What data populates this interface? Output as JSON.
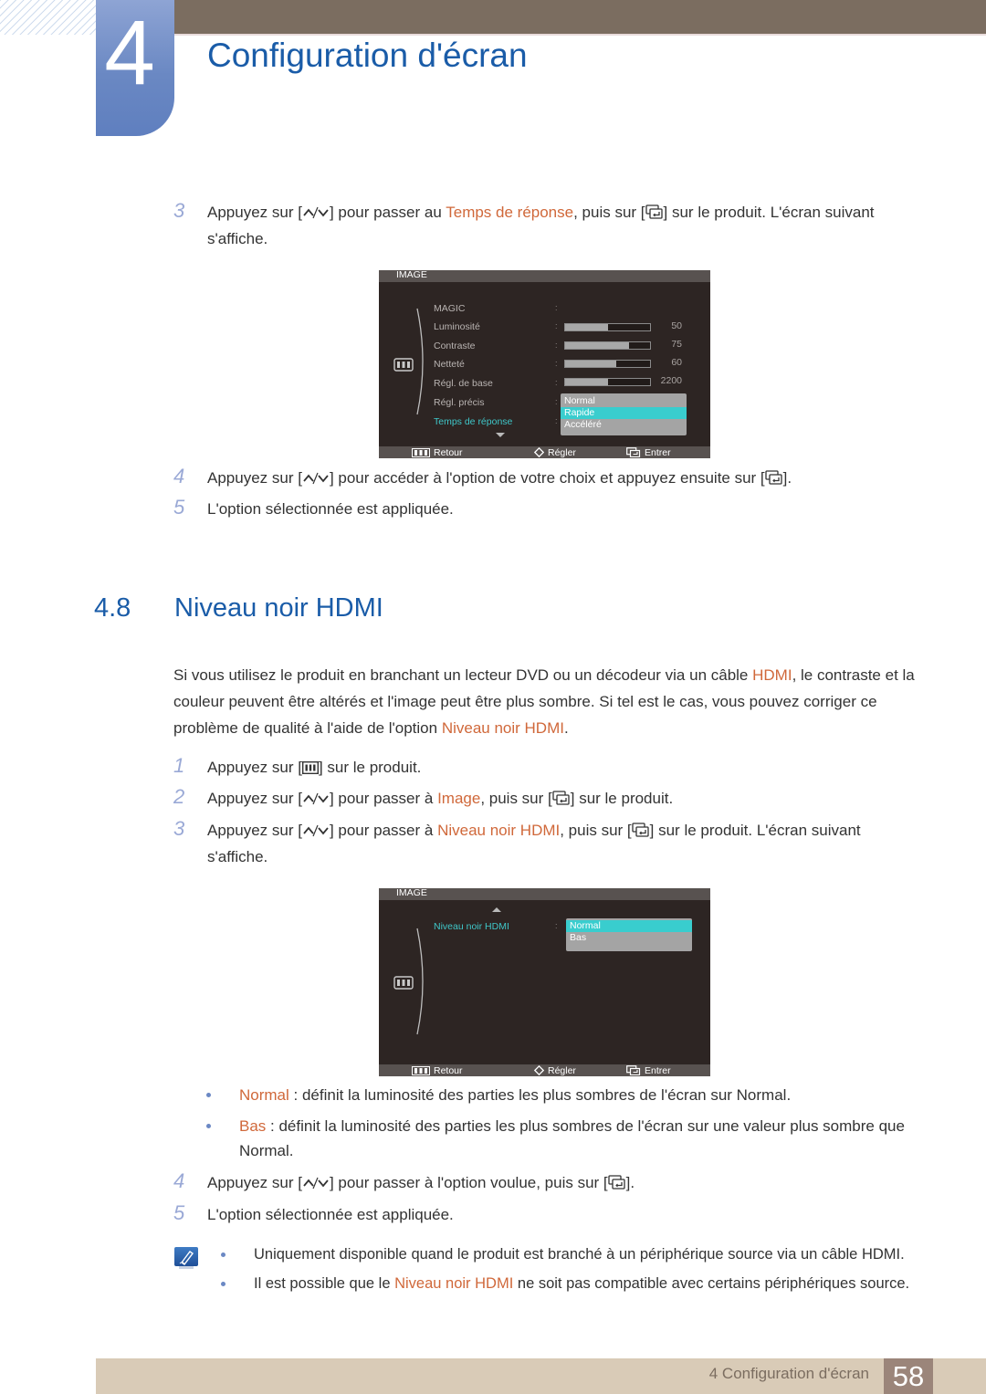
{
  "header": {
    "chapter_number": "4",
    "chapter_title": "Configuration d'écran"
  },
  "colors": {
    "title_blue": "#1a5ca8",
    "highlight_orange": "#d0683a",
    "step_number": "#9aa9d6",
    "osd_selected": "#3fc7c9",
    "header_bar": "#7b6d60",
    "footer_bar": "#d9cbb7"
  },
  "icons": {
    "up_down": "up-down-arrow-icon",
    "enter": "enter-source-icon",
    "menu": "menu-icon",
    "note": "note-pencil-icon"
  },
  "steps_a": [
    {
      "num": "3",
      "parts": [
        "Appuyez sur [",
        "] pour passer au ",
        "Temps de réponse",
        ", puis sur [",
        "] sur le produit. L'écran suivant s'affiche."
      ]
    },
    {
      "num": "4",
      "parts": [
        "Appuyez sur [",
        "] pour accéder à l'option de votre choix et appuyez ensuite sur [",
        "]."
      ]
    },
    {
      "num": "5",
      "parts": [
        "L'option sélectionnée est appliquée."
      ]
    }
  ],
  "osd1": {
    "title": "IMAGE",
    "items": [
      {
        "label": "MAGIC",
        "value": null
      },
      {
        "label": "Luminosité",
        "value": "50",
        "fill": 0.5
      },
      {
        "label": "Contraste",
        "value": "75",
        "fill": 0.75
      },
      {
        "label": "Netteté",
        "value": "60",
        "fill": 0.6
      },
      {
        "label": "Régl. de base",
        "value": "2200",
        "fill": 0.5
      },
      {
        "label": "Régl. précis",
        "value": null
      },
      {
        "label": "Temps de réponse",
        "value": null,
        "selected": true
      }
    ],
    "dropdown": [
      "Normal",
      "Rapide",
      "Accéléré"
    ],
    "dropdown_selected": "Rapide",
    "footer": {
      "back": "Retour",
      "adjust": "Régler",
      "enter": "Entrer"
    }
  },
  "section": {
    "number": "4.8",
    "title": "Niveau noir HDMI",
    "intro_parts": [
      "Si vous utilisez le produit en branchant un lecteur DVD ou un décodeur via un câble ",
      "HDMI",
      ", le contraste et la couleur peuvent être altérés et l'image peut être plus sombre. Si tel est le cas, vous pouvez corriger ce problème de qualité à l'aide de l'option ",
      "Niveau noir HDMI",
      "."
    ]
  },
  "steps_b": [
    {
      "num": "1",
      "parts": [
        "Appuyez sur [",
        "] sur le produit."
      ]
    },
    {
      "num": "2",
      "parts": [
        "Appuyez sur [",
        "] pour passer à ",
        "Image",
        ", puis sur [",
        "] sur le produit."
      ]
    },
    {
      "num": "3",
      "parts": [
        "Appuyez sur [",
        "] pour passer à ",
        "Niveau noir HDMI",
        ", puis sur [",
        "] sur le produit. L'écran suivant s'affiche."
      ]
    }
  ],
  "osd2": {
    "title": "IMAGE",
    "item_label": "Niveau noir HDMI",
    "dropdown": [
      "Normal",
      "Bas"
    ],
    "dropdown_selected": "Normal",
    "footer": {
      "back": "Retour",
      "adjust": "Régler",
      "enter": "Entrer"
    }
  },
  "options": [
    {
      "name": "Normal",
      "desc": " : définit la luminosité des parties les plus sombres de l'écran sur Normal."
    },
    {
      "name": "Bas",
      "desc": " : définit la luminosité des parties les plus sombres de l'écran sur une valeur plus sombre que Normal."
    }
  ],
  "steps_c": [
    {
      "num": "4",
      "parts": [
        "Appuyez sur [",
        "] pour passer à l'option voulue, puis sur [",
        "]."
      ]
    },
    {
      "num": "5",
      "parts": [
        "L'option sélectionnée est appliquée."
      ]
    }
  ],
  "notes": [
    {
      "parts": [
        "Uniquement disponible quand le produit est branché à un périphérique source via un câble HDMI."
      ]
    },
    {
      "parts": [
        "Il est possible que le ",
        "Niveau noir HDMI",
        " ne soit pas compatible avec certains périphériques source."
      ]
    }
  ],
  "footer": {
    "text": "4 Configuration d'écran",
    "page": "58"
  }
}
